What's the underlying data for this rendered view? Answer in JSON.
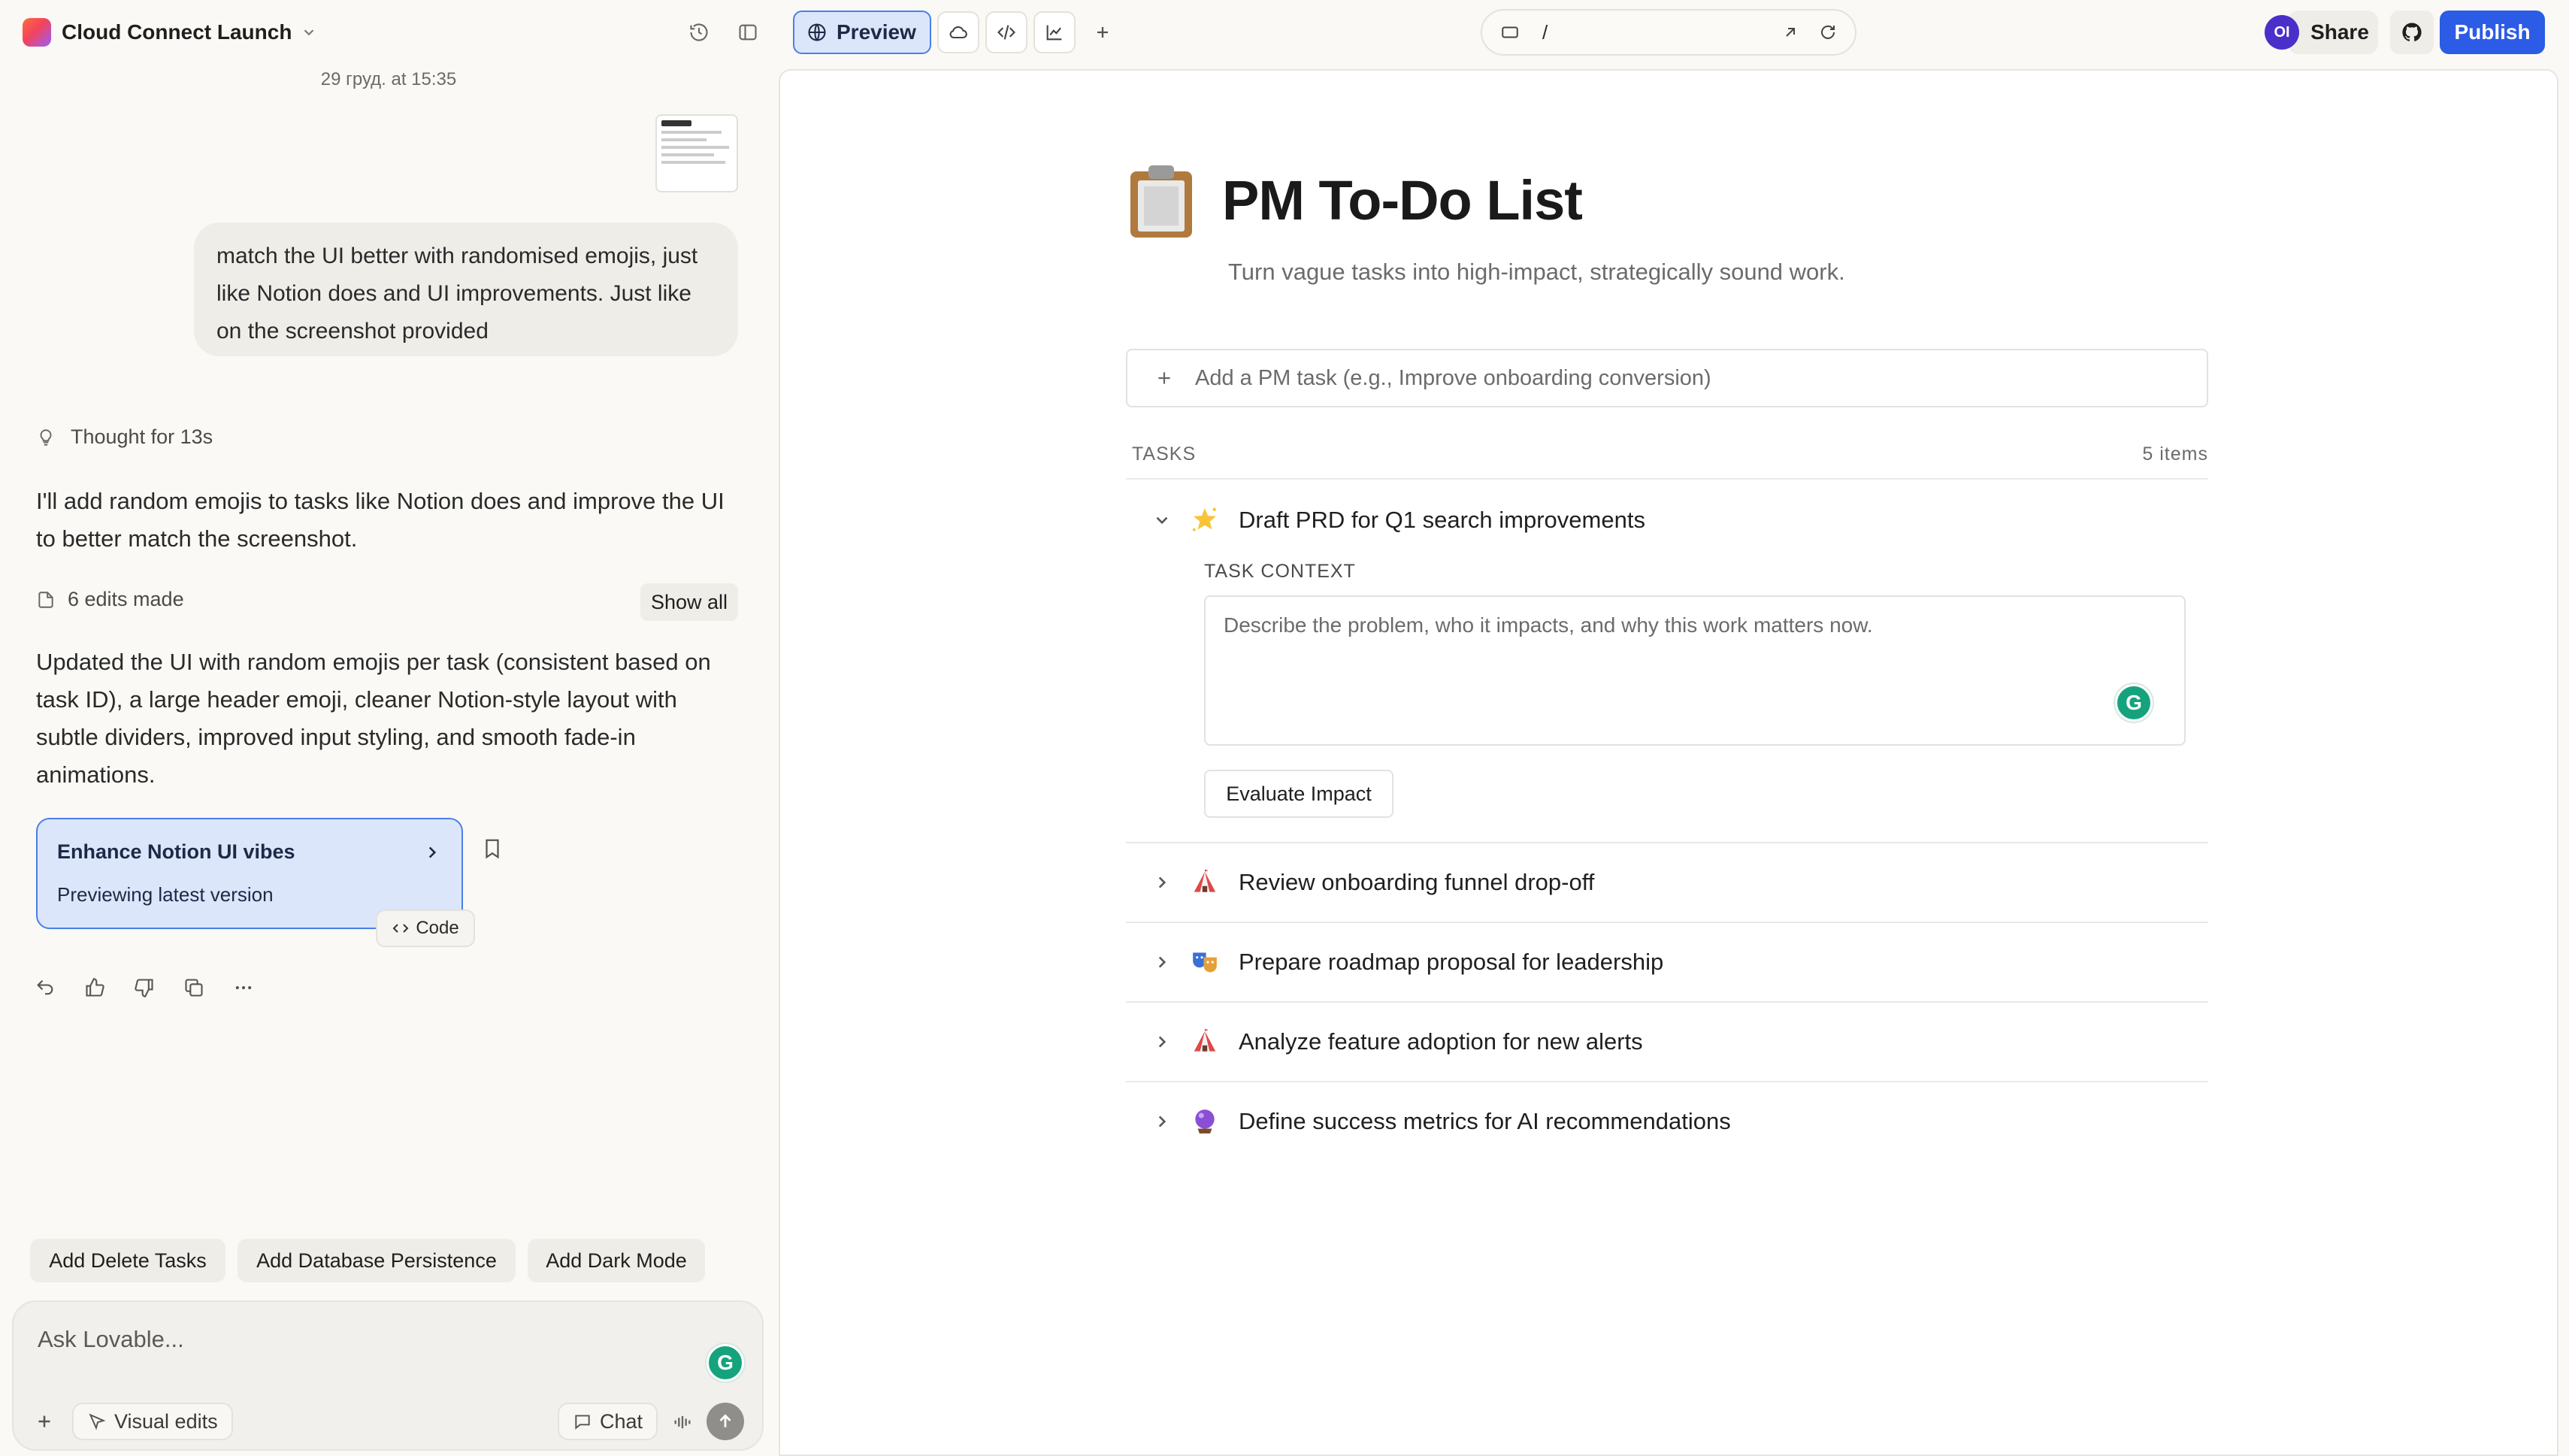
{
  "topbar": {
    "project_title": "Cloud Connect Launch",
    "preview_label": "Preview",
    "url_path": "/",
    "avatar_initials": "OI",
    "share_label": "Share",
    "publish_label": "Publish",
    "colors": {
      "accent": "#2c5be6",
      "preview_bg": "#dbe6fb",
      "avatar": "#4b2fc9"
    }
  },
  "chat": {
    "timestamp": "29 груд. at 15:35",
    "user_message": "match the UI better with randomised emojis, just like Notion does and UI improvements. Just like on the screenshot provided",
    "thought_label": "Thought for 13s",
    "reply_1": "I'll add random emojis to tasks like Notion does and improve the UI to better match the screenshot.",
    "edits_label": "6 edits made",
    "show_all_label": "Show all",
    "reply_2": "Updated the UI with random emojis per task (consistent based on task ID), a large header emoji, cleaner Notion-style layout with subtle dividers, improved input styling, and smooth fade-in animations.",
    "version_card": {
      "title": "Enhance Notion UI vibes",
      "subtitle": "Previewing latest version"
    },
    "code_label": "Code",
    "suggestions": [
      "Add Delete Tasks",
      "Add Database Persistence",
      "Add Dark Mode"
    ],
    "input_placeholder": "Ask Lovable...",
    "visual_edits_label": "Visual edits",
    "chat_mode_label": "Chat"
  },
  "preview": {
    "title": "PM To-Do List",
    "subtitle": "Turn vague tasks into high-impact, strategically sound work.",
    "add_task_placeholder": "Add a PM task (e.g., Improve onboarding conversion)",
    "tasks_header": "TASKS",
    "items_count": "5 items",
    "task_context_label": "TASK CONTEXT",
    "context_placeholder": "Describe the problem, who it impacts, and why this work matters now.",
    "evaluate_label": "Evaluate Impact",
    "tasks": [
      {
        "label": "Draft PRD for Q1 search improvements",
        "emoji": "star-sparkle-icon",
        "expanded": true
      },
      {
        "label": "Review onboarding funnel drop-off",
        "emoji": "circus-tent-icon",
        "expanded": false
      },
      {
        "label": "Prepare roadmap proposal for leadership",
        "emoji": "theater-masks-icon",
        "expanded": false
      },
      {
        "label": "Analyze feature adoption for new alerts",
        "emoji": "circus-tent-icon",
        "expanded": false
      },
      {
        "label": "Define success metrics for AI recommendations",
        "emoji": "crystal-ball-icon",
        "expanded": false
      }
    ]
  }
}
